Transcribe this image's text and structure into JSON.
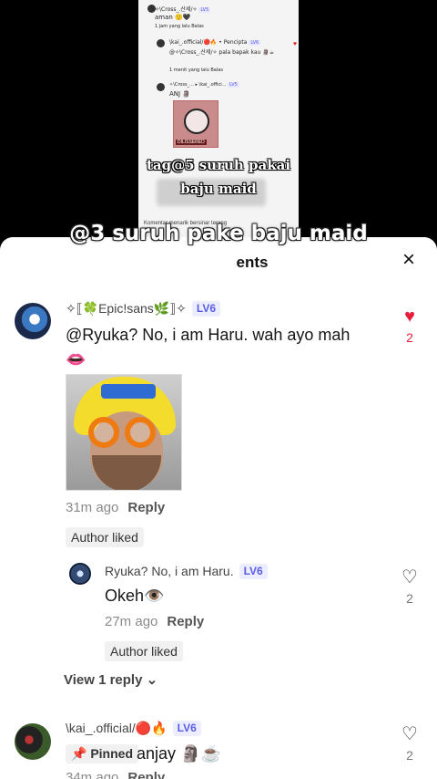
{
  "video": {
    "overlay_tag": "tag@5 suruh pakai baju maid",
    "inner": {
      "c1_name": "✧\\Cross_.산세/✧",
      "c1_lv": "LV5",
      "c1_text": "aman 🙂🖤",
      "c1_meta": "1 jam yang lalu   Balas",
      "c2_name": "\\kai_.official/🔴🔥 • Pencipta",
      "c2_lv": "LV6",
      "c2_text": "@✧\\Cross_.산세/✧ pala bapak kau 🗿☕",
      "c2_meta": "1 menit yang lalu   Balas",
      "c3_name": "✧\\Cross_... ▸ \\kai_.offici...",
      "c3_lv": "LV5",
      "c3_text": "ANJ 🗿",
      "img_tag": "DILISSERED",
      "footer": "Komentar menarik bersinar terang"
    }
  },
  "sheet": {
    "caption": "@3 suruh pake baju maid",
    "title_tail": "ents",
    "close_icon": "×"
  },
  "comments": [
    {
      "name": "✧⟦🍀Epic!sans🌿⟧✧",
      "lv": "LV6",
      "text": "@Ryuka? No, i am Haru. wah ayo mah",
      "text2": "👄",
      "time": "31m ago",
      "reply": "Reply",
      "author_liked": "Author liked",
      "likes": "2"
    },
    {
      "name": "Ryuka? No, i am Haru.",
      "lv": "LV6",
      "text": "Okeh👁️",
      "time": "27m ago",
      "reply": "Reply",
      "author_liked": "Author liked",
      "likes": "2"
    },
    {
      "view_replies": "View 1 reply ⌄"
    },
    {
      "name": "\\kai_.official/🔴🔥",
      "lv": "LV6",
      "pinned": "📌 Pinned",
      "text": "anjay 🗿☕",
      "time": "34m ago",
      "reply": "Reply",
      "likes": "2"
    }
  ]
}
